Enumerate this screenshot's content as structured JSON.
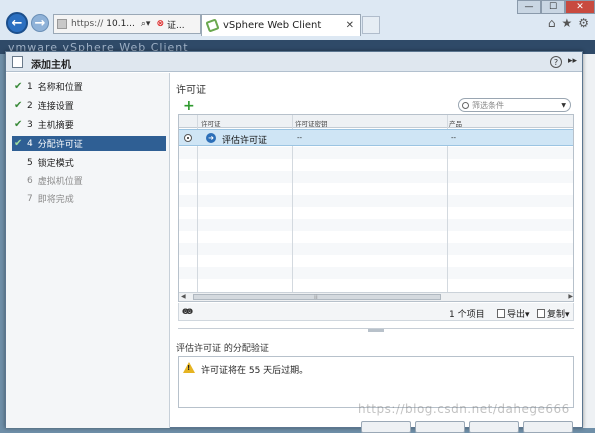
{
  "browser": {
    "url_prefix": "https://",
    "url_host": "10.1...",
    "cert_error": "证...",
    "tab_title": "vSphere Web Client",
    "window_buttons": {
      "minimize": "—",
      "maximize": "☐",
      "close": "✕"
    }
  },
  "app": {
    "brand": "vmware vSphere Web Client"
  },
  "dialog": {
    "title": "添加主机",
    "steps": [
      {
        "number": "1",
        "label": "名称和位置",
        "status": "done"
      },
      {
        "number": "2",
        "label": "连接设置",
        "status": "done"
      },
      {
        "number": "3",
        "label": "主机摘要",
        "status": "done"
      },
      {
        "number": "4",
        "label": "分配许可证",
        "status": "active"
      },
      {
        "number": "5",
        "label": "锁定模式",
        "status": "pending"
      },
      {
        "number": "6",
        "label": "虚拟机位置",
        "status": "disabled"
      },
      {
        "number": "7",
        "label": "即将完成",
        "status": "disabled"
      }
    ],
    "section_title": "许可证",
    "filter_placeholder": "筛选条件",
    "columns": [
      "许可证",
      "许可证密钥",
      "产品"
    ],
    "rows": [
      {
        "license": "评估许可证",
        "key": "--",
        "product": "--",
        "selected": true
      }
    ],
    "item_count": "1 个项目",
    "export_label": "导出",
    "copy_label": "复制",
    "detail_title": "评估许可证 的分配验证",
    "detail_message": "许可证将在 55 天后过期。"
  },
  "watermark": "https://blog.csdn.net/dahege666",
  "colors": {
    "accent": "#2f5f94",
    "selected_row": "#cfe5f5",
    "check_green": "#3b8b3b",
    "warning": "#e6b422"
  }
}
